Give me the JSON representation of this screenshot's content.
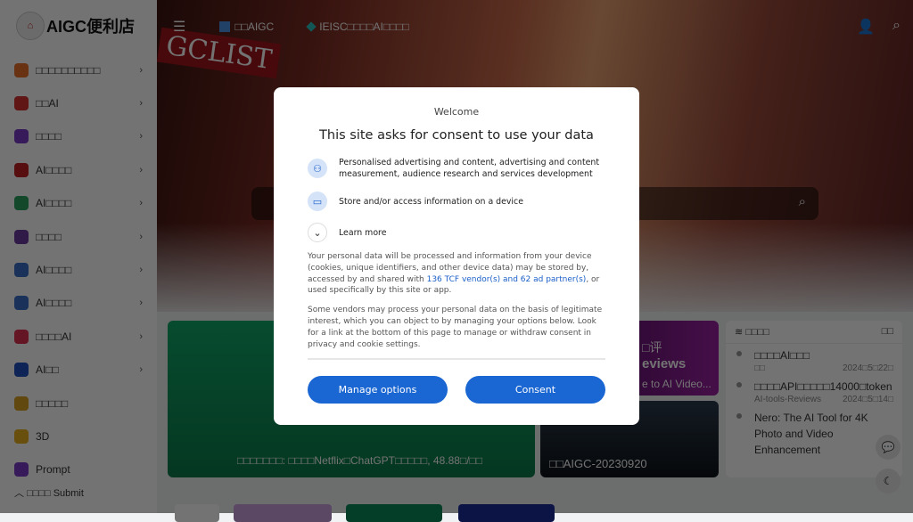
{
  "logo": {
    "text": "AIGC便利店",
    "badge": "AIGC"
  },
  "sidebar": {
    "items": [
      {
        "label": "□□□□□□□□□□",
        "color": "#e8702a",
        "chevron": true
      },
      {
        "label": "□□AI",
        "color": "#d83030",
        "chevron": true
      },
      {
        "label": "□□□□",
        "color": "#7a3ac8",
        "chevron": true
      },
      {
        "label": "AI□□□□",
        "color": "#c02020",
        "chevron": true
      },
      {
        "label": "AI□□□□",
        "color": "#2aa060",
        "chevron": true
      },
      {
        "label": "□□□□",
        "color": "#6a3aa0",
        "chevron": true
      },
      {
        "label": "AI□□□□",
        "color": "#3a70c8",
        "chevron": true
      },
      {
        "label": "AI□□□□",
        "color": "#3a70c8",
        "chevron": true
      },
      {
        "label": "□□□□AI",
        "color": "#e03050",
        "chevron": true
      },
      {
        "label": "AI□□",
        "color": "#2050c0",
        "chevron": true
      },
      {
        "label": "□□□□□",
        "color": "#d8a020",
        "chevron": false
      },
      {
        "label": "3D",
        "color": "#e8b020",
        "chevron": false
      },
      {
        "label": "Prompt",
        "color": "#7a3ac8",
        "chevron": false
      }
    ],
    "submit": "□□□□ Submit"
  },
  "header": {
    "links": [
      "□□AIGC",
      "IEISC□□□□AI□□□□"
    ]
  },
  "cards": {
    "main": "□□□□□□□: □□□□Netflix□ChatGPT□□□□□, 48.88□/□□",
    "review_top": "□评",
    "review_title": "eviews",
    "review_sub": "e to AI Video...",
    "dark": "□□AIGC-20230920"
  },
  "news": {
    "title": "□□□□",
    "more": "□□",
    "items": [
      {
        "title": "□□□□AI□□□",
        "source": "□□",
        "date": "2024□5□22□"
      },
      {
        "title": "□□□□API□□□□□14000□token",
        "source": "AI-tools-Reviews",
        "date": "2024□5□14□"
      },
      {
        "title": "Nero: The AI Tool for 4K Photo and Video Enhancement",
        "source": "",
        "date": ""
      }
    ]
  },
  "consent": {
    "welcome": "Welcome",
    "title": "This site asks for consent to use your data",
    "purposes": [
      "Personalised advertising and content, advertising and content measurement, audience research and services development",
      "Store and/or access information on a device"
    ],
    "learn_more": "Learn more",
    "body1_pre": "Your personal data will be processed and information from your device (cookies, unique identifiers, and other device data) may be stored by, accessed by and shared with ",
    "body1_link": "136 TCF vendor(s) and 62 ad partner(s)",
    "body1_post": ", or used specifically by this site or app.",
    "body2": "Some vendors may process your personal data on the basis of legitimate interest, which you can object to by managing your options below. Look for a link at the bottom of this page to manage or withdraw consent in privacy and cookie settings.",
    "manage": "Manage options",
    "consent": "Consent"
  }
}
